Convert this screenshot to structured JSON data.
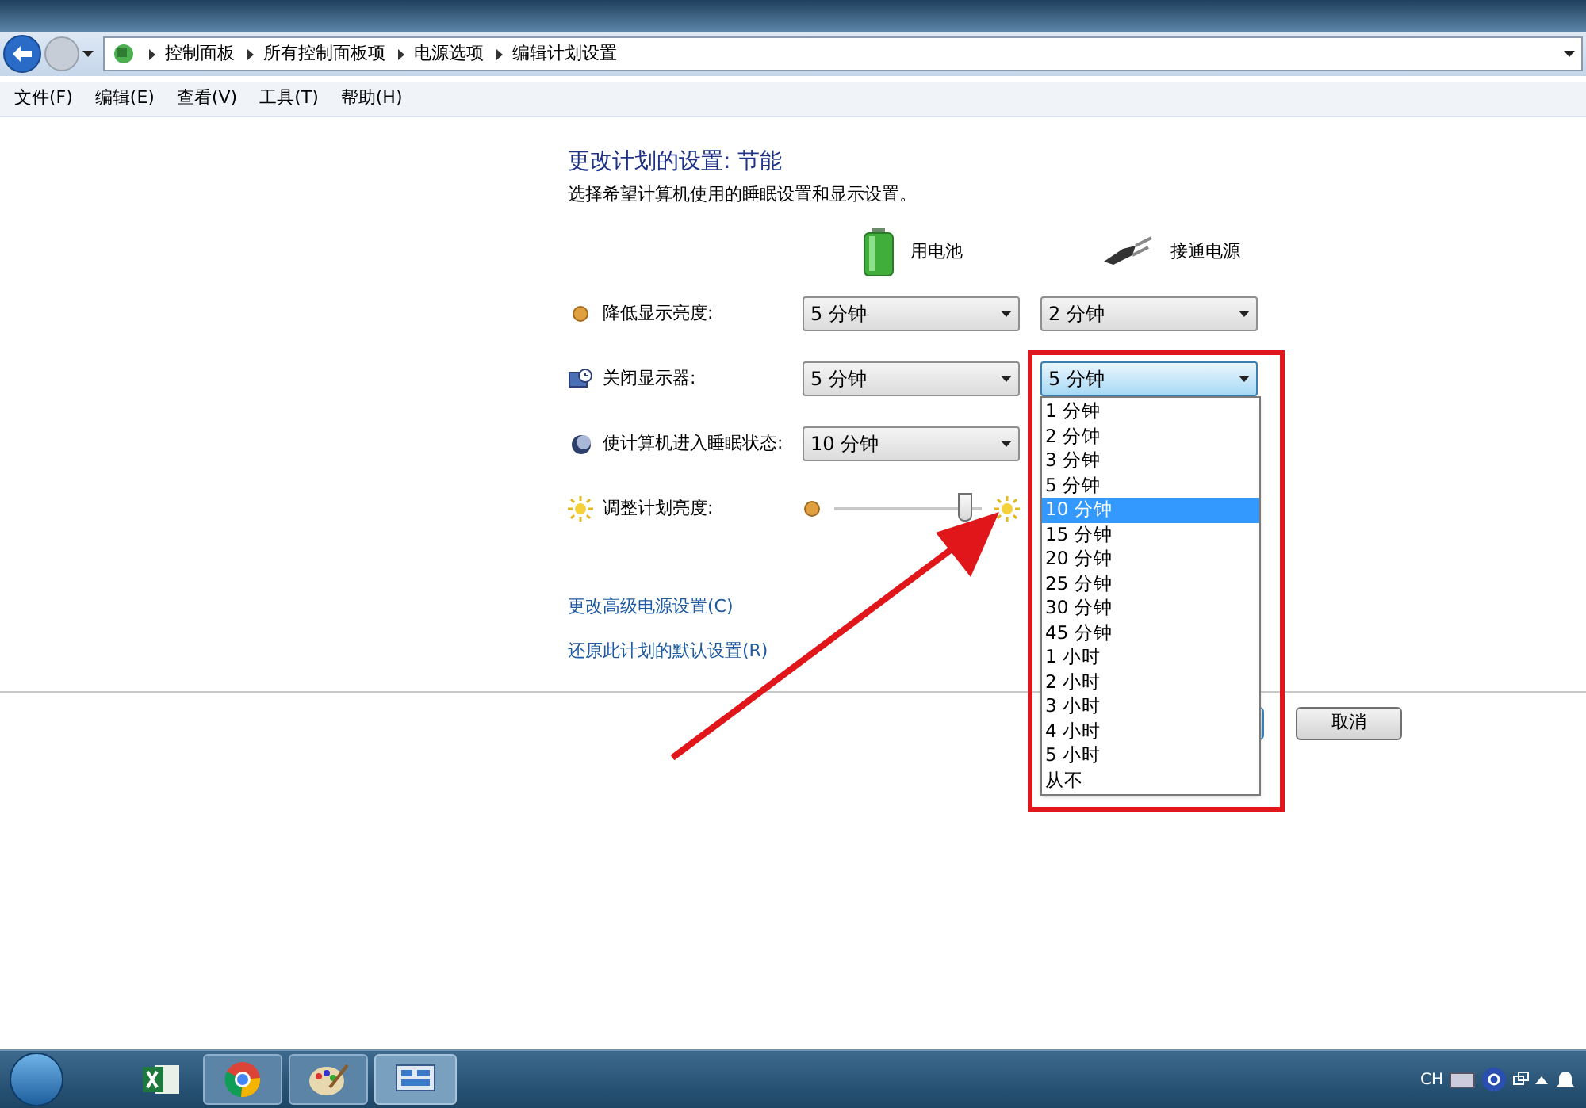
{
  "address_bar": {
    "breadcrumbs": [
      "控制面板",
      "所有控制面板项",
      "电源选项",
      "编辑计划设置"
    ]
  },
  "menu_bar": [
    "文件(F)",
    "编辑(E)",
    "查看(V)",
    "工具(T)",
    "帮助(H)"
  ],
  "heading": "更改计划的设置: 节能",
  "subtitle": "选择希望计算机使用的睡眠设置和显示设置。",
  "columns": [
    {
      "label": "用电池",
      "kind": "battery"
    },
    {
      "label": "接通电源",
      "kind": "plug"
    }
  ],
  "settings": [
    {
      "label": "降低显示亮度:",
      "kind": "dropdowns",
      "values": [
        {
          "value": "5 分钟",
          "open": false
        },
        {
          "value": "2 分钟",
          "open": false
        }
      ]
    },
    {
      "label": "关闭显示器:",
      "kind": "dropdowns",
      "values": [
        {
          "value": "5 分钟",
          "open": false
        },
        {
          "value": "5 分钟",
          "open": true
        }
      ]
    },
    {
      "label": "使计算机进入睡眠状态:",
      "kind": "dropdowns",
      "values": [
        {
          "value": "10 分钟",
          "open": false
        }
      ]
    },
    {
      "label": "调整计划亮度:",
      "kind": "slider",
      "level": 0.88
    }
  ],
  "dropdown_options": [
    {
      "label": "1 分钟",
      "selected": false
    },
    {
      "label": "2 分钟",
      "selected": false
    },
    {
      "label": "3 分钟",
      "selected": false
    },
    {
      "label": "5 分钟",
      "selected": false
    },
    {
      "label": "10 分钟",
      "selected": true
    },
    {
      "label": "15 分钟",
      "selected": false
    },
    {
      "label": "20 分钟",
      "selected": false
    },
    {
      "label": "25 分钟",
      "selected": false
    },
    {
      "label": "30 分钟",
      "selected": false
    },
    {
      "label": "45 分钟",
      "selected": false
    },
    {
      "label": "1 小时",
      "selected": false
    },
    {
      "label": "2 小时",
      "selected": false
    },
    {
      "label": "3 小时",
      "selected": false
    },
    {
      "label": "4 小时",
      "selected": false
    },
    {
      "label": "5 小时",
      "selected": false
    },
    {
      "label": "从不",
      "selected": false
    }
  ],
  "links": [
    "更改高级电源设置(C)",
    "还原此计划的默认设置(R)"
  ],
  "buttons": [
    "取消"
  ],
  "tray": {
    "language": "CH"
  }
}
